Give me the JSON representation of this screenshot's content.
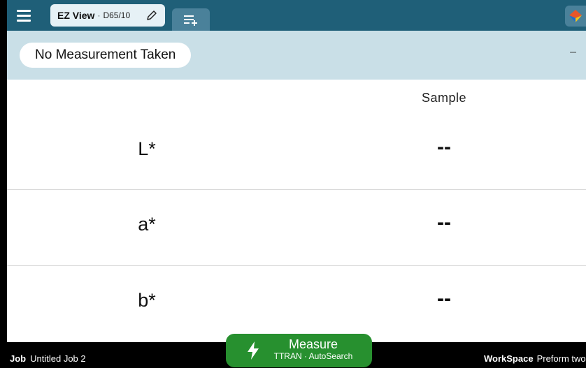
{
  "header": {
    "tab_name": "EZ View",
    "tab_separator": "·",
    "tab_illuminant": "D65/10"
  },
  "status": {
    "message": "No Measurement Taken",
    "right_value": "–"
  },
  "table": {
    "column_header": "Sample",
    "rows": [
      {
        "label": "L*",
        "value": "--"
      },
      {
        "label": "a*",
        "value": "--"
      },
      {
        "label": "b*",
        "value": "--"
      }
    ]
  },
  "footer": {
    "job_label": "Job",
    "job_value": "Untitled Job 2",
    "workspace_label": "WorkSpace",
    "workspace_value": "Preform two"
  },
  "measure": {
    "label": "Measure",
    "sub_label": "TTRAN · AutoSearch"
  },
  "colors": {
    "topbar": "#1f5f78",
    "status_band": "#c9dfe7",
    "measure_button": "#27902f"
  }
}
